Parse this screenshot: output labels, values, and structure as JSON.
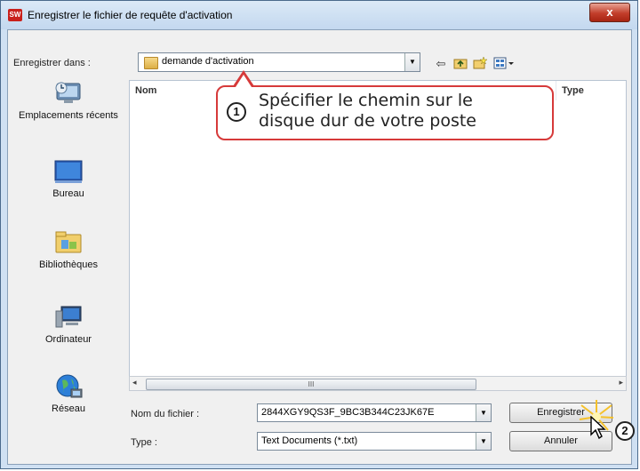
{
  "window": {
    "title": "Enregistrer le fichier de requête d'activation",
    "app_icon_text": "SW",
    "close_label": "x"
  },
  "save_in": {
    "label": "Enregistrer dans :",
    "value": "demande d'activation"
  },
  "toolbar_icons": [
    "back-icon",
    "up-folder-icon",
    "new-folder-icon",
    "views-menu-icon"
  ],
  "places": [
    {
      "label": "Emplacements récents",
      "icon": "recent-places-icon"
    },
    {
      "label": "Bureau",
      "icon": "desktop-icon"
    },
    {
      "label": "Bibliothèques",
      "icon": "libraries-icon"
    },
    {
      "label": "Ordinateur",
      "icon": "computer-icon"
    },
    {
      "label": "Réseau",
      "icon": "network-icon"
    }
  ],
  "file_list": {
    "columns": [
      "Nom",
      "Type"
    ],
    "scroll_grip": "III"
  },
  "filename": {
    "label": "Nom du fichier :",
    "value": "2844XGY9QS3F_9BC3B344C23JK67E"
  },
  "filetype": {
    "label": "Type :",
    "value": "Text Documents (*.txt)"
  },
  "buttons": {
    "save": "Enregistrer",
    "cancel": "Annuler"
  },
  "annotations": {
    "callout_number": "1",
    "callout_text_line1": "Spécifier le chemin sur le",
    "callout_text_line2": "disque dur de votre poste",
    "step2_number": "2"
  },
  "colors": {
    "accent_red": "#d63a3a",
    "title_bar": "#c3d8ef",
    "close_button": "#c23e2b"
  }
}
